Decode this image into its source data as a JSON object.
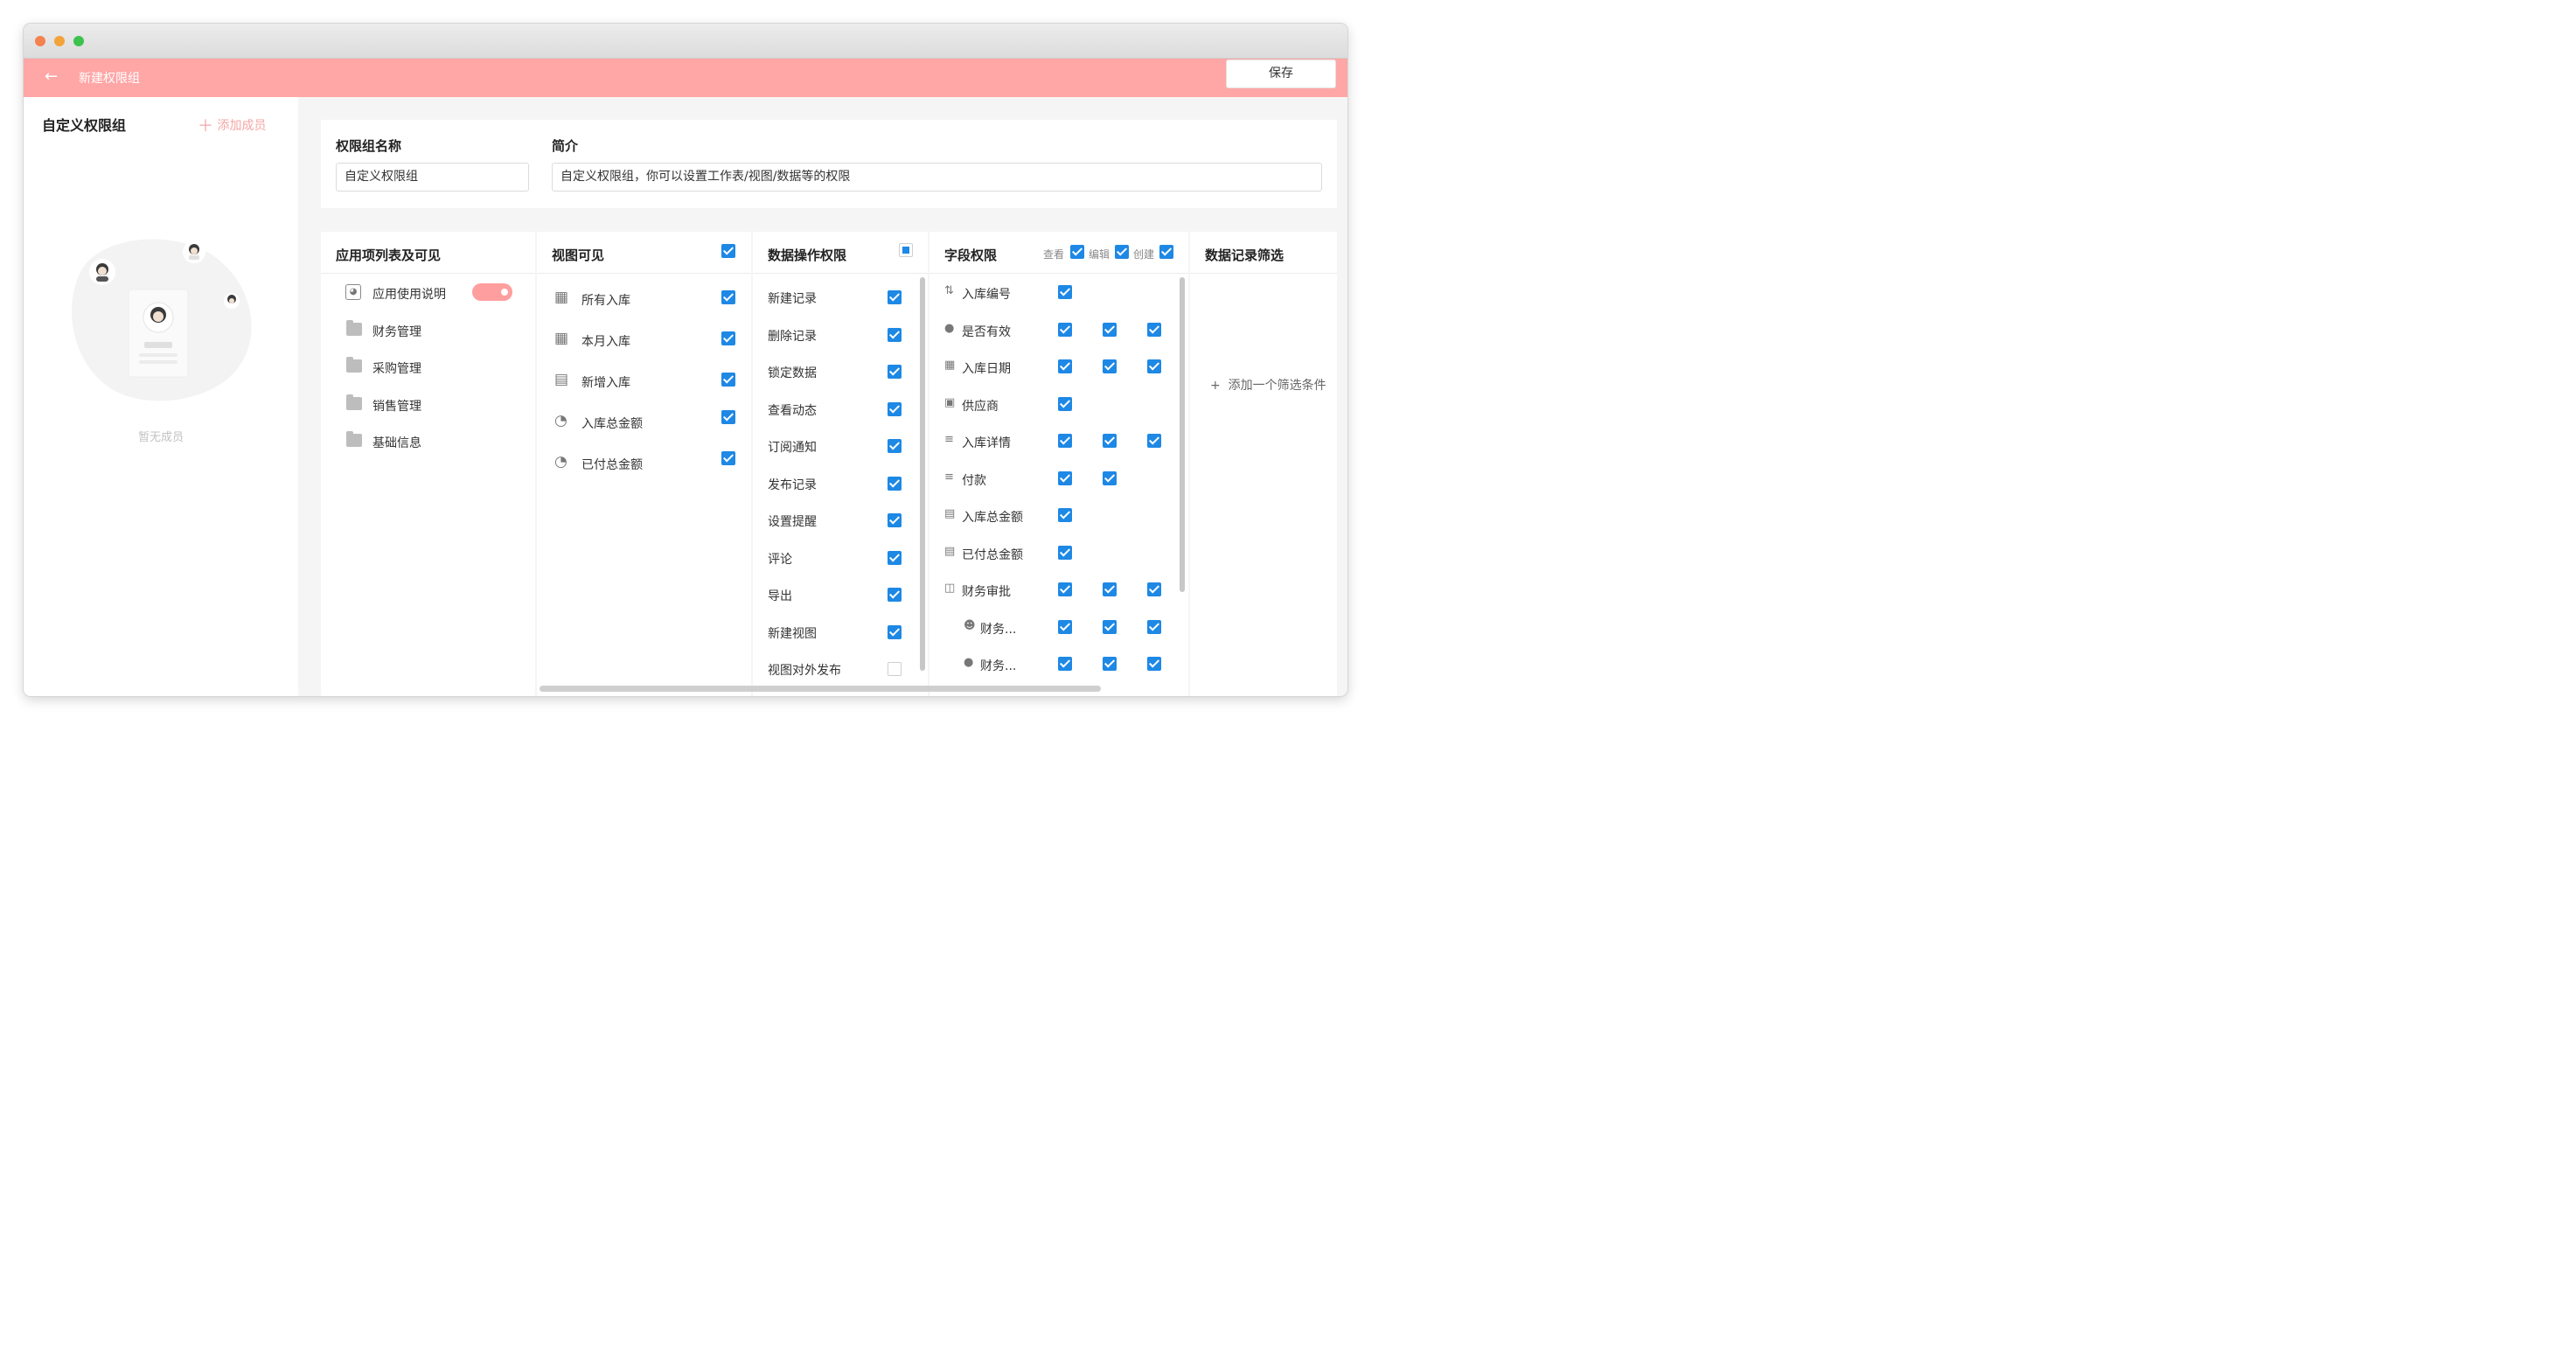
{
  "app": {
    "title": "新建权限组",
    "save_label": "保存",
    "back_icon": "arrow-left-icon"
  },
  "colors": {
    "accent": "#ffa6a6",
    "checkbox": "#1e88e5"
  },
  "left": {
    "title": "自定义权限组",
    "add_member": "添加成员",
    "empty_text": "暂无成员"
  },
  "form": {
    "name_label": "权限组名称",
    "name_value": "自定义权限组",
    "desc_label": "简介",
    "desc_value": "自定义权限组，你可以设置工作表/视图/数据等的权限"
  },
  "apps": {
    "title": "应用项列表及可见",
    "items": [
      {
        "label": "应用使用说明",
        "icon": "dashboard-icon",
        "toggle": true
      },
      {
        "label": "财务管理",
        "icon": "folder-icon"
      },
      {
        "label": "采购管理",
        "icon": "folder-icon"
      },
      {
        "label": "销售管理",
        "icon": "folder-icon"
      },
      {
        "label": "基础信息",
        "icon": "folder-icon"
      }
    ]
  },
  "views": {
    "title": "视图可见",
    "items": [
      {
        "label": "所有入库",
        "icon": "table-icon"
      },
      {
        "label": "本月入库",
        "icon": "table-icon"
      },
      {
        "label": "新增入库",
        "icon": "form-icon"
      },
      {
        "label": "入库总金额",
        "icon": "pie-chart-icon"
      },
      {
        "label": "已付总金额",
        "icon": "pie-chart-icon"
      }
    ]
  },
  "ops": {
    "title": "数据操作权限",
    "items": [
      {
        "label": "新建记录",
        "checked": true
      },
      {
        "label": "删除记录",
        "checked": true
      },
      {
        "label": "锁定数据",
        "checked": true
      },
      {
        "label": "查看动态",
        "checked": true
      },
      {
        "label": "订阅通知",
        "checked": true
      },
      {
        "label": "发布记录",
        "checked": true
      },
      {
        "label": "设置提醒",
        "checked": true
      },
      {
        "label": "评论",
        "checked": true
      },
      {
        "label": "导出",
        "checked": true
      },
      {
        "label": "新建视图",
        "checked": true
      },
      {
        "label": "视图对外发布",
        "checked": false
      }
    ]
  },
  "fields": {
    "title": "字段权限",
    "headers": {
      "view": "查看",
      "edit": "编辑",
      "create": "创建"
    },
    "items": [
      {
        "label": "入库编号",
        "icon": "sort-number-icon",
        "view": true,
        "edit": null,
        "create": null
      },
      {
        "label": "是否有效",
        "icon": "toggle-circle-icon",
        "view": true,
        "edit": true,
        "create": true
      },
      {
        "label": "入库日期",
        "icon": "calendar-icon",
        "view": true,
        "edit": true,
        "create": true
      },
      {
        "label": "供应商",
        "icon": "lookup-icon",
        "view": true,
        "edit": null,
        "create": null
      },
      {
        "label": "入库详情",
        "icon": "sub-table-icon",
        "view": true,
        "edit": true,
        "create": true
      },
      {
        "label": "付款",
        "icon": "sub-table-icon",
        "view": true,
        "edit": true,
        "create": null
      },
      {
        "label": "入库总金额",
        "icon": "formula-icon",
        "view": true,
        "edit": null,
        "create": null
      },
      {
        "label": "已付总金额",
        "icon": "formula-icon",
        "view": true,
        "edit": null,
        "create": null
      },
      {
        "label": "财务审批",
        "icon": "section-icon",
        "view": true,
        "edit": true,
        "create": true
      },
      {
        "label": "财务...",
        "icon": "user-group-icon",
        "view": true,
        "edit": true,
        "create": true
      },
      {
        "label": "财务...",
        "icon": "toggle-circle-icon",
        "view": true,
        "edit": true,
        "create": true
      }
    ]
  },
  "filter": {
    "title": "数据记录筛选",
    "add_label": "添加一个筛选条件"
  }
}
